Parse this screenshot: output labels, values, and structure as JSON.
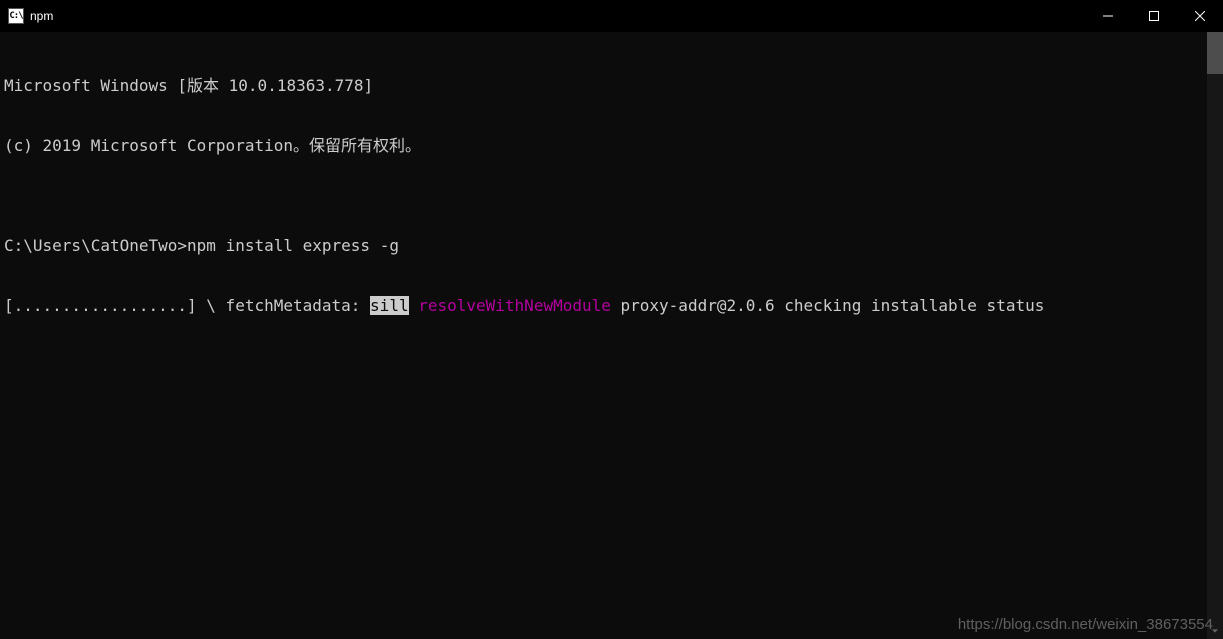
{
  "titlebar": {
    "icon_text": "C:\\",
    "title": "npm"
  },
  "terminal": {
    "line1": "Microsoft Windows [版本 10.0.18363.778]",
    "line2": "(c) 2019 Microsoft Corporation。保留所有权利。",
    "blank1": "",
    "prompt_line": {
      "prompt": "C:\\Users\\CatOneTwo>",
      "command": "npm install express -g"
    },
    "progress_line": {
      "pre": "[..................] \\ fetchMetadata: ",
      "sill": "sill",
      "space1": " ",
      "magenta": "resolveWithNewModule",
      "rest": " proxy-addr@2.0.6 checking installable status"
    }
  },
  "watermark": "https://blog.csdn.net/weixin_38673554"
}
